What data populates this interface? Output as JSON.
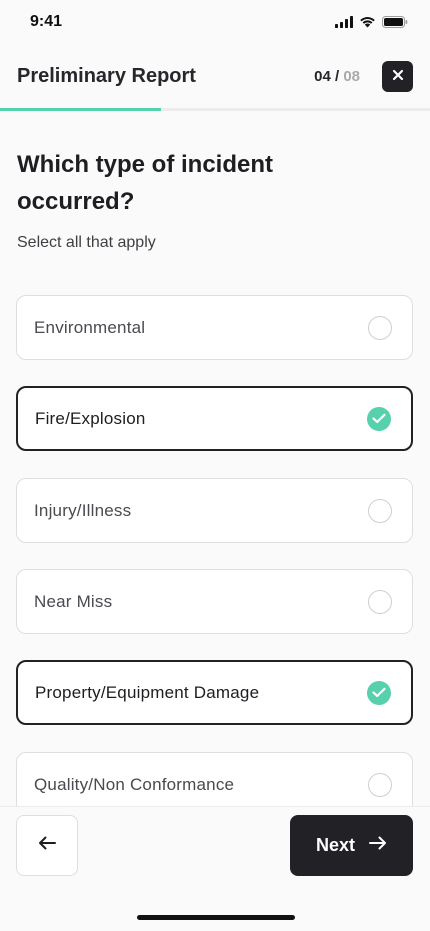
{
  "status_bar": {
    "time": "9:41"
  },
  "header": {
    "title": "Preliminary Report",
    "step_current": "04",
    "step_separator": "/",
    "step_total": "08",
    "progress_fraction": 0.375
  },
  "question": {
    "title": "Which type of incident occurred?",
    "subtitle": "Select all that apply"
  },
  "options": [
    {
      "label": "Environmental",
      "selected": false
    },
    {
      "label": "Fire/Explosion",
      "selected": true
    },
    {
      "label": "Injury/Illness",
      "selected": false
    },
    {
      "label": "Near Miss",
      "selected": false
    },
    {
      "label": "Property/Equipment Damage",
      "selected": true
    },
    {
      "label": "Quality/Non Conformance",
      "selected": false
    }
  ],
  "footer": {
    "next_label": "Next"
  },
  "colors": {
    "accent": "#57d1ab",
    "dark": "#222226"
  }
}
